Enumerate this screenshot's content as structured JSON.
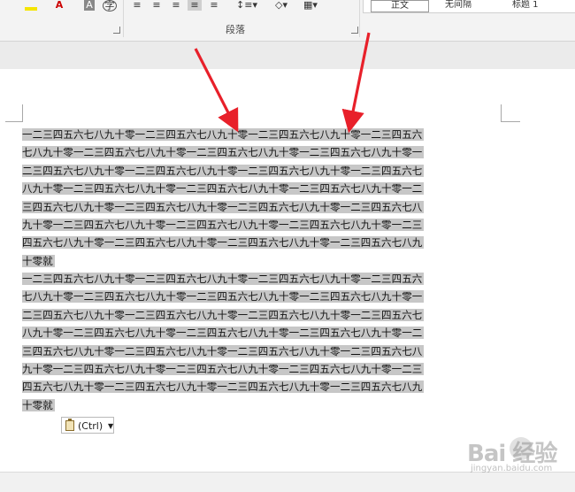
{
  "ribbon": {
    "paragraph_group_label": "段落",
    "style_items": [
      "正文",
      "无间隔",
      "标题 1"
    ],
    "active_style": "正文"
  },
  "document": {
    "paragraphs": [
      {
        "lines": [
          "一二三四五六七八九十零一二三四五六七八九十零一二三四五六七八九十零一二三四五六",
          "七八九十零一二三四五六七八九十零一二三四五六七八九十零一二三四五六七八九十零一",
          "二三四五六七八九十零一二三四五六七八九十零一二三四五六七八九十零一二三四五六七",
          "八九十零一二三四五六七八九十零一二三四五六七八九十零一二三四五六七八九十零一二",
          "三四五六七八九十零一二三四五六七八九十零一二三四五六七八九十零一二三四五六七八",
          "九十零一二三四五六七八九十零一二三四五六七八九十零一二三四五六七八九十零一二三",
          "四五六七八九十零一二三四五六七八九十零一二三四五六七八九十零一二三四五六七八九",
          "十零就"
        ]
      },
      {
        "lines": [
          "一二三四五六七八九十零一二三四五六七八九十零一二三四五六七八九十零一二三四五六",
          "七八九十零一二三四五六七八九十零一二三四五六七八九十零一二三四五六七八九十零一",
          "二三四五六七八九十零一二三四五六七八九十零一二三四五六七八九十零一二三四五六七",
          "八九十零一二三四五六七八九十零一二三四五六七八九十零一二三四五六七八九十零一二",
          "三四五六七八九十零一二三四五六七八九十零一二三四五六七八九十零一二三四五六七八",
          "九十零一二三四五六七八九十零一二三四五六七八九十零一二三四五六七八九十零一二三",
          "四五六七八九十零一二三四五六七八九十零一二三四五六七八九十零一二三四五六七八九",
          "十零就"
        ]
      }
    ]
  },
  "paste_options": {
    "label": "(Ctrl)"
  },
  "watermark": {
    "brand": "Bai 经验",
    "sub": "jingyan.baidu.com"
  },
  "colors": {
    "selection": "#c7c7c7",
    "arrow": "#e8202a"
  }
}
